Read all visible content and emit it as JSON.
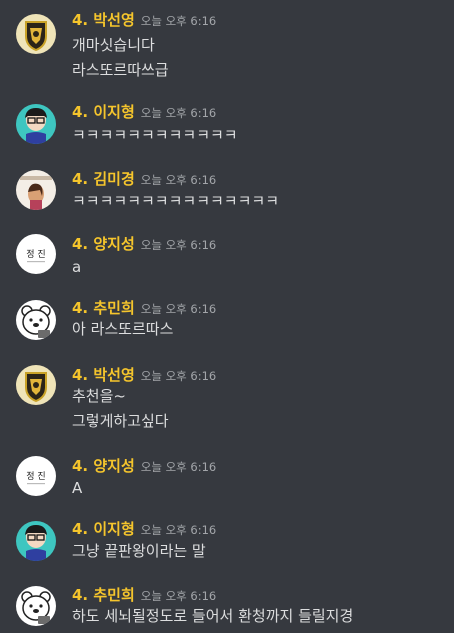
{
  "theme": {
    "background": "#36393f",
    "author_color": "#f5c52c",
    "text_color": "#dcddde",
    "timestamp_color": "#a3a6aa"
  },
  "messages": [
    {
      "author": "4. 박선영",
      "timestamp": "오늘 오후 6:16",
      "avatar": "hufflepuff-crest-avatar",
      "lines": [
        "개마싯습니다",
        "라스또르따쓰급"
      ]
    },
    {
      "author": "4. 이지형",
      "timestamp": "오늘 오후 6:16",
      "avatar": "cartoon-boy-avatar",
      "lines": [
        "ㅋㅋㅋㅋㅋㅋㅋㅋㅋㅋㅋㅋ"
      ]
    },
    {
      "author": "4. 김미경",
      "timestamp": "오늘 오후 6:16",
      "avatar": "photo-avatar",
      "lines": [
        "ㅋㅋㅋㅋㅋㅋㅋㅋㅋㅋㅋㅋㅋㅋㅋ"
      ]
    },
    {
      "author": "4. 양지성",
      "timestamp": "오늘 오후 6:16",
      "avatar": "jeongjin-text-avatar",
      "avatar_text": "정 진",
      "lines": [
        "a"
      ]
    },
    {
      "author": "4. 추민희",
      "timestamp": "오늘 오후 6:16",
      "avatar": "bear-avatar",
      "lines": [
        "아 라스또르따스"
      ]
    },
    {
      "author": "4. 박선영",
      "timestamp": "오늘 오후 6:16",
      "avatar": "hufflepuff-crest-avatar",
      "lines": [
        "추천을~",
        "그렇게하고싶다"
      ]
    },
    {
      "author": "4. 양지성",
      "timestamp": "오늘 오후 6:16",
      "avatar": "jeongjin-text-avatar",
      "avatar_text": "정 진",
      "lines": [
        "A"
      ]
    },
    {
      "author": "4. 이지형",
      "timestamp": "오늘 오후 6:16",
      "avatar": "cartoon-boy-avatar",
      "lines": [
        "그냥 끝판왕이라는 말"
      ]
    },
    {
      "author": "4. 추민희",
      "timestamp": "오늘 오후 6:16",
      "avatar": "bear-avatar",
      "lines": [
        "하도 세뇌될정도로 들어서 환청까지 들릴지경"
      ]
    }
  ]
}
